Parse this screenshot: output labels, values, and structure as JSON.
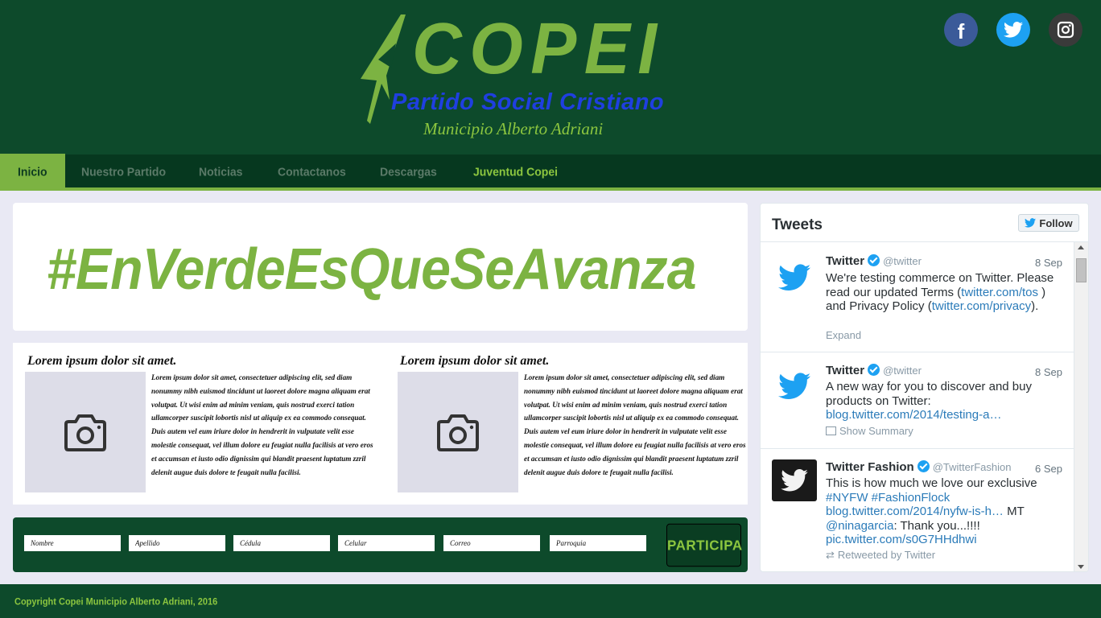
{
  "header": {
    "logo_text": "COPEI",
    "logo_subtitle": "Partido Social Cristiano",
    "logo_municipality": "Municipio Alberto Adriani",
    "social": [
      "facebook-icon",
      "twitter-icon",
      "instagram-icon"
    ]
  },
  "nav": {
    "items": [
      {
        "label": "Inicio"
      },
      {
        "label": "Nuestro Partido"
      },
      {
        "label": "Noticias"
      },
      {
        "label": "Contactanos"
      },
      {
        "label": "Descargas"
      },
      {
        "label": "Juventud Copei"
      }
    ]
  },
  "hero": {
    "hashtag": "#EnVerdeEsQueSeAvanza"
  },
  "articles": [
    {
      "title": "Lorem ipsum dolor sit amet.",
      "body": "Lorem ipsum dolor sit amet, consectetuer adipiscing elit, sed diam nonummy nibh euismod tincidunt ut laoreet dolore magna aliquam erat volutpat. Ut wisi enim ad minim veniam, quis nostrud exerci tation ullamcorper suscipit lobortis nisl ut aliquip ex ea commodo consequat. Duis autem vel eum iriure dolor in hendrerit in vulputate velit esse molestie consequat, vel illum dolore eu feugiat nulla facilisis at vero eros et accumsan et iusto odio dignissim qui blandit praesent luptatum zzril delenit augue duis dolore te feugait nulla facilisi."
    },
    {
      "title": "Lorem ipsum dolor sit amet.",
      "body": "Lorem ipsum dolor sit amet, consectetuer adipiscing elit, sed diam nonummy nibh euismod tincidunt ut laoreet dolore magna aliquam erat volutpat. Ut wisi enim ad minim veniam, quis nostrud exerci tation ullamcorper suscipit lobortis nisl ut aliquip ex ea commodo consequat. Duis autem vel eum iriure dolor in hendrerit in vulputate velit esse molestie consequat, vel illum dolore eu feugiat nulla facilisis at vero eros et accumsan et iusto odio dignissim qui blandit praesent luptatum zzril delenit augue duis dolore te feugait nulla facilisi."
    }
  ],
  "form": {
    "fields": [
      {
        "placeholder": "Nombre"
      },
      {
        "placeholder": "Apellido"
      },
      {
        "placeholder": "Cédula"
      },
      {
        "placeholder": "Celular"
      },
      {
        "placeholder": "Correo"
      },
      {
        "placeholder": "Parroquia"
      }
    ],
    "submit_label": "PARTICIPA"
  },
  "tweets": {
    "title": "Tweets",
    "follow_label": "Follow",
    "items": [
      {
        "name": "Twitter",
        "handle": "@twitter",
        "date": "8 Sep",
        "text_parts": [
          "We're testing commerce on Twitter. Please read our updated Terms (",
          "twitter.com/tos",
          " ) and Privacy Policy (",
          "twitter.com/privacy",
          ")."
        ],
        "meta": "Expand"
      },
      {
        "name": "Twitter",
        "handle": "@twitter",
        "date": "8 Sep",
        "text_parts": [
          "A new way for you to discover and buy products on Twitter: ",
          "blog.twitter.com/2014/testing-a…"
        ],
        "meta": "Show Summary"
      },
      {
        "name": "Twitter Fashion",
        "handle": "@TwitterFashion",
        "date": "6 Sep",
        "text_parts": [
          "This is how much we love our exclusive ",
          "#NYFW",
          " ",
          "#FashionFlock",
          " ",
          "blog.twitter.com/2014/nyfw-is-h…",
          " MT ",
          "@ninagarcia",
          ": Thank you...!!!! ",
          "pic.twitter.com/s0G7HHdhwi"
        ],
        "meta": "Retweeted by Twitter"
      }
    ]
  },
  "footer": {
    "copyright": "Copyright Copei Municipio Alberto Adriani, 2016"
  },
  "colors": {
    "brand_dark_green": "#0d4a2b",
    "brand_light_green": "#7cb342",
    "logo_blue": "#1f3fe0",
    "twitter_blue": "#1da1f2"
  }
}
